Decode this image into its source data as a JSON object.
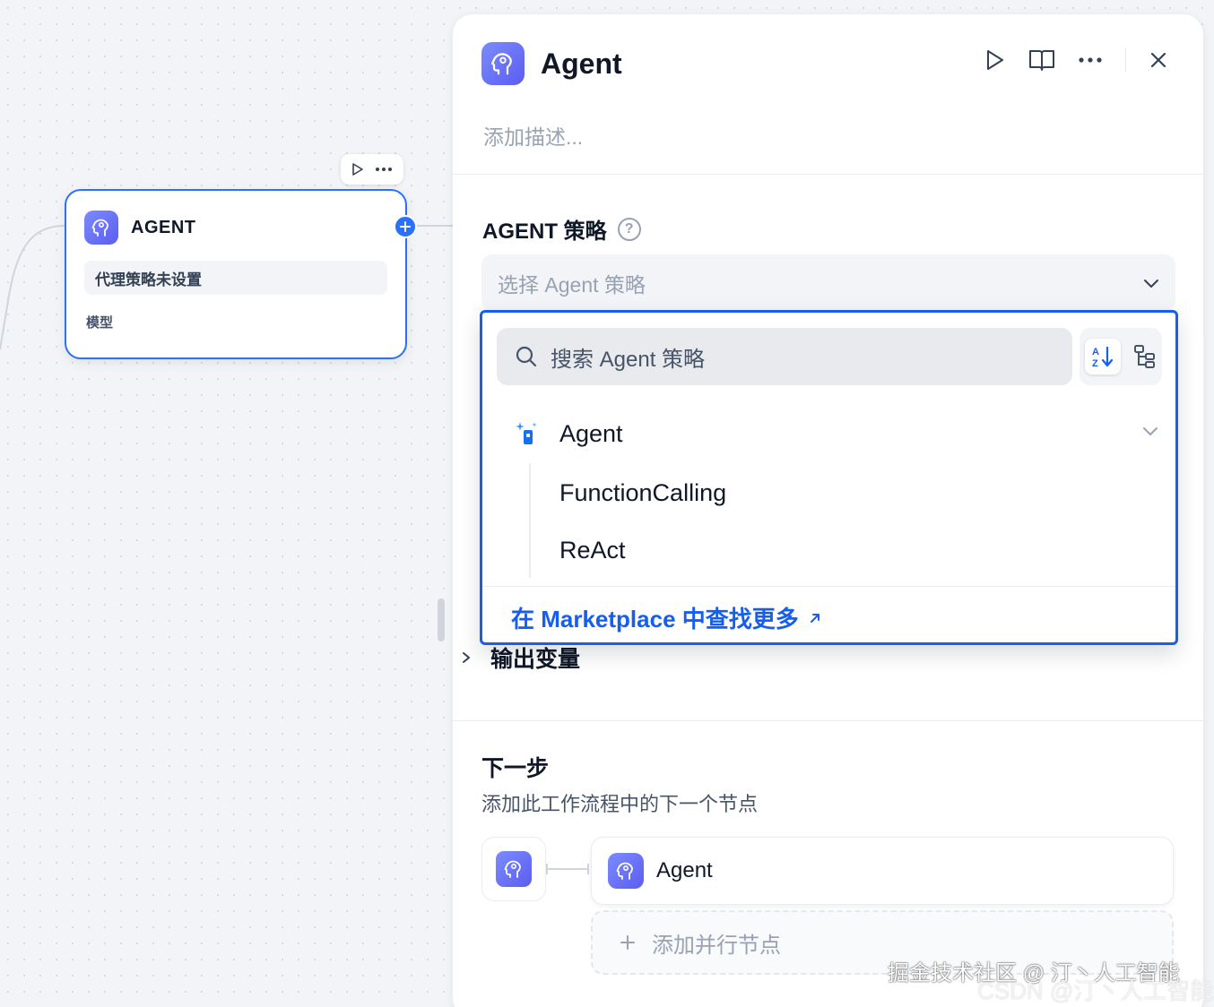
{
  "canvas": {
    "node": {
      "title": "AGENT",
      "strategy_status": "代理策略未设置",
      "model_label": "模型"
    }
  },
  "panel": {
    "title": "Agent",
    "description_placeholder": "添加描述...",
    "strategy": {
      "title": "AGENT 策略",
      "select_placeholder": "选择 Agent 策略"
    },
    "dropdown": {
      "search_placeholder": "搜索 Agent 策略",
      "group_label": "Agent",
      "items": [
        "FunctionCalling",
        "ReAct"
      ],
      "footer_link": "在 Marketplace 中查找更多"
    },
    "output_vars": "输出变量",
    "next_step": {
      "title": "下一步",
      "subtitle": "添加此工作流程中的下一个节点",
      "next_node": "Agent",
      "add_parallel": "添加并行节点"
    }
  },
  "watermarks": [
    "掘金技术社区 @ 汀丶人工智能",
    "CSDN @汀丶人工智能"
  ],
  "colors": {
    "accent": "#155eef",
    "node_border": "#2970ff",
    "icon_gradient": [
      "#7b8cff",
      "#5c5cf0"
    ]
  },
  "icons": [
    "agent-brain-icon",
    "play-icon",
    "book-icon",
    "more-icon",
    "close-icon",
    "help-icon",
    "chevron-down-icon",
    "search-icon",
    "sort-az-icon",
    "tree-view-icon",
    "sparkle-agent-icon",
    "external-link-icon",
    "chevron-right-icon",
    "plus-icon"
  ]
}
